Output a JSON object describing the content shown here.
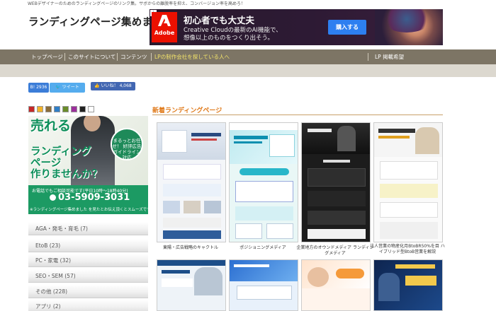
{
  "header": {
    "tagline": "WEBデザイナーのためのランディングページのリンク集。サボからの離脱率を抑え、コンバージョン率を高めろ！",
    "site_title": "ランディングページ集めました。"
  },
  "ad": {
    "brand": "Adobe",
    "headline": "初心者でも大丈夫",
    "subline_1": "Creative Cloudの最新のAI機能で、",
    "subline_2": "想像以上のものをつくり出そう。",
    "cta": "購入する",
    "info_icon": "info-icon",
    "close_icon": "close-icon"
  },
  "nav": {
    "items": [
      "トップページ",
      "このサイトについて",
      "コンテンツ",
      "LPの制作会社を探している人へ"
    ],
    "right_item": "LP 掲載希望"
  },
  "share": {
    "hatena": "B! 2936",
    "tweet": "ツイート",
    "like": "いいね！ 4,068"
  },
  "swatches": [
    "#c62828",
    "#f2b32a",
    "#8a6d3b",
    "#2f7ec7",
    "#6a8c2a",
    "#9c2f9c",
    "#222222",
    "#ffffff"
  ],
  "sidebar_ad": {
    "title_1": "売れる",
    "title_2": "ランディング",
    "title_3": "ページ",
    "title_4": "作りませんか？",
    "badge": "まるっとお任せ！ 好評広告 ガイドライン 対応",
    "note": "お電話でもご相談可能です(平日10時～18時40分)",
    "phone": "03-5909-3031",
    "footer": "※ランディングページ集めました を見たとお伝え頂くとスムーズです。"
  },
  "categories": [
    {
      "label": "AGA・発毛・育毛 (7)"
    },
    {
      "label": "EtoB (23)"
    },
    {
      "label": "PC・家電 (32)"
    },
    {
      "label": "SEO・SEM (57)"
    },
    {
      "label": "その他 (228)"
    },
    {
      "label": "アプリ (2)"
    }
  ],
  "main": {
    "section_title": "新着ランディングページ",
    "cards": [
      {
        "caption": "東陽・広告戦略のキャクトル"
      },
      {
        "caption": "ポジショニングメディア"
      },
      {
        "caption": "企業地方のオウンドメディア ランディングメディア"
      },
      {
        "caption": "法人営業の物産化月BtoBR50%を目 ハイブリッド型BtoB営業を解説"
      },
      {
        "caption": ""
      },
      {
        "caption": ""
      },
      {
        "caption": ""
      },
      {
        "caption": ""
      }
    ]
  },
  "colors": {
    "nav_bg": "#7d7565",
    "nav_active": "#f3e46a",
    "section_title": "#e07a1a",
    "accent_green": "#1c9a63"
  }
}
